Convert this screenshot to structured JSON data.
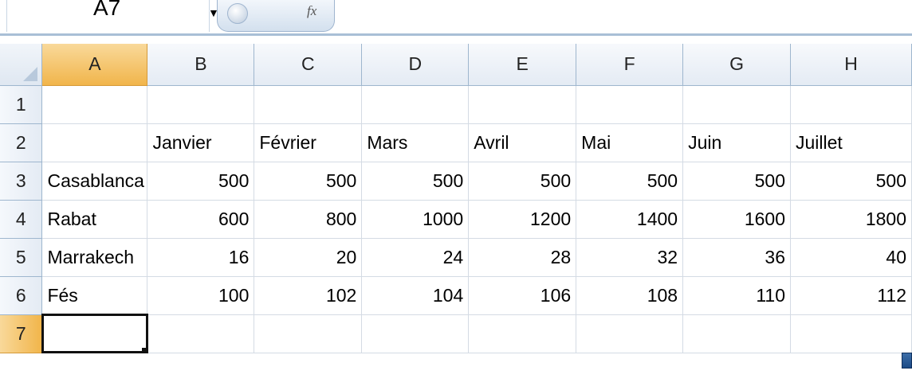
{
  "name_box": {
    "value": "A7"
  },
  "formula_bar": {
    "fx_label": "fx"
  },
  "column_headers": [
    "A",
    "B",
    "C",
    "D",
    "E",
    "F",
    "G",
    "H"
  ],
  "active_column": "A",
  "active_row": "7",
  "rows": [
    {
      "label": "1",
      "cells": [
        "",
        "",
        "",
        "",
        "",
        "",
        "",
        ""
      ]
    },
    {
      "label": "2",
      "cells": [
        "",
        "Janvier",
        "Février",
        "Mars",
        "Avril",
        "Mai",
        "Juin",
        "Juillet"
      ]
    },
    {
      "label": "3",
      "cells": [
        "Casablanca",
        "500",
        "500",
        "500",
        "500",
        "500",
        "500",
        "500"
      ]
    },
    {
      "label": "4",
      "cells": [
        "Rabat",
        "600",
        "800",
        "1000",
        "1200",
        "1400",
        "1600",
        "1800"
      ]
    },
    {
      "label": "5",
      "cells": [
        "Marrakech",
        "16",
        "20",
        "24",
        "28",
        "32",
        "36",
        "40"
      ]
    },
    {
      "label": "6",
      "cells": [
        "Fés",
        "100",
        "102",
        "104",
        "106",
        "108",
        "110",
        "112"
      ]
    },
    {
      "label": "7",
      "cells": [
        "",
        "",
        "",
        "",
        "",
        "",
        "",
        ""
      ]
    }
  ]
}
